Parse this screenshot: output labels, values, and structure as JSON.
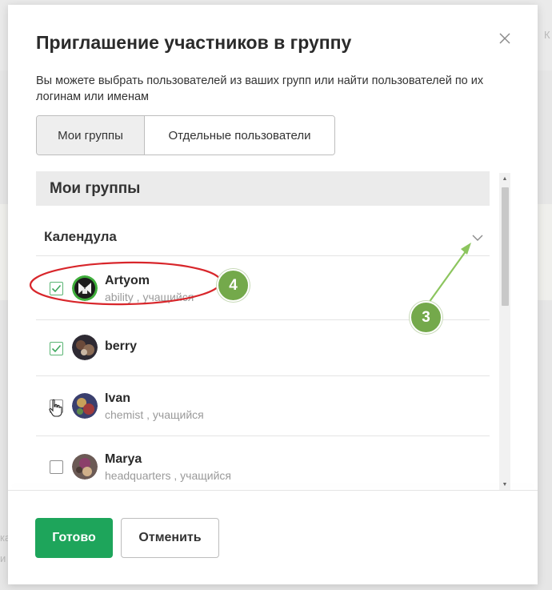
{
  "dialog": {
    "title": "Приглашение участников в группу",
    "description": "Вы можете выбрать пользователей из ваших групп или найти пользователей по их логинам или именам",
    "tabs": [
      {
        "label": "Мои группы",
        "active": true
      },
      {
        "label": "Отдельные пользователи",
        "active": false
      }
    ],
    "section_header": "Мои группы",
    "group": {
      "name": "Календула",
      "expanded": true
    },
    "users": [
      {
        "name": "Artyom",
        "subtitle": "ability , учащийся",
        "checked": true
      },
      {
        "name": "berry",
        "subtitle": "",
        "checked": true
      },
      {
        "name": "Ivan",
        "subtitle": "chemist , учащийся",
        "checked": false
      },
      {
        "name": "Marya",
        "subtitle": "headquarters , учащийся",
        "checked": false
      }
    ],
    "buttons": {
      "done": "Готово",
      "cancel": "Отменить"
    }
  },
  "background_hints": {
    "top_right": "К",
    "left_1": "ка",
    "left_2": "и"
  },
  "annotations": {
    "step_3": "3",
    "step_4": "4"
  },
  "colors": {
    "primary_green": "#1ea55b",
    "annotation_green": "#74a94b",
    "highlight_red": "#d8262b",
    "checkbox_green": "#5bb574"
  }
}
